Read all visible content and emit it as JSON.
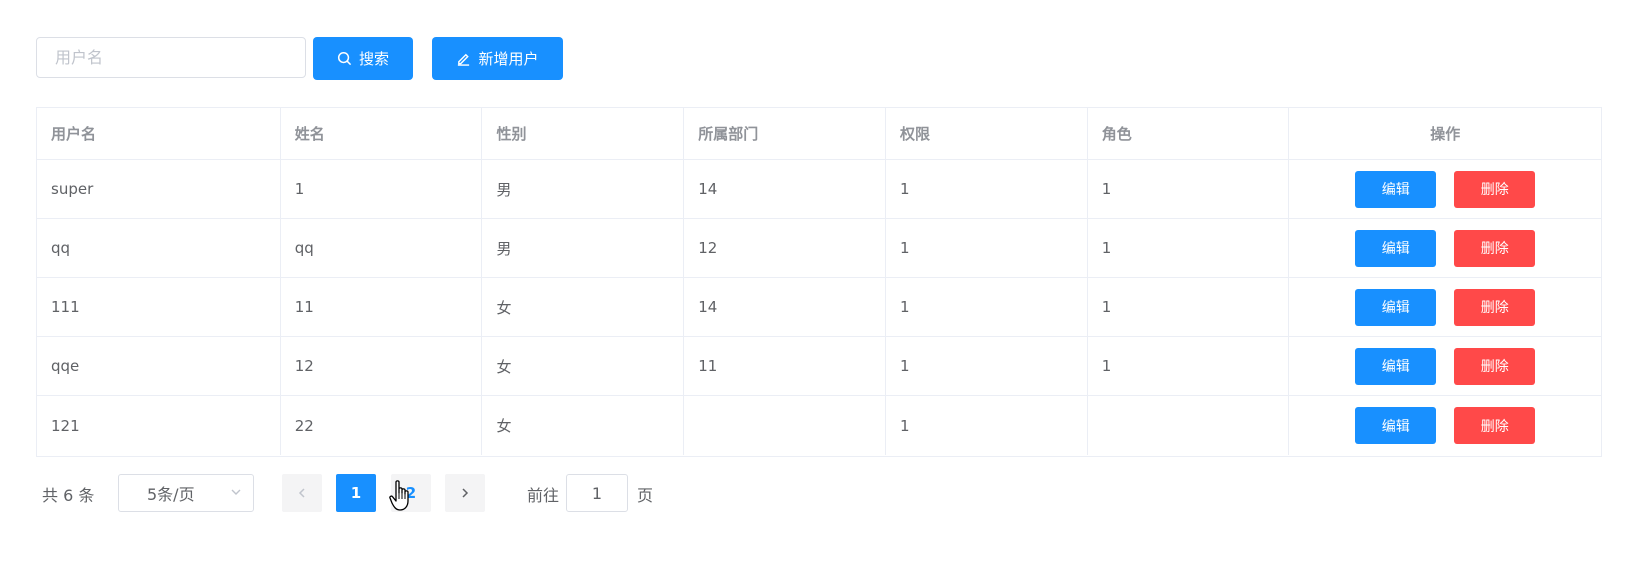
{
  "toolbar": {
    "search_placeholder": "用户名",
    "search_value": "",
    "search_label": "搜索",
    "add_label": "新增用户",
    "search_icon": "search-icon",
    "add_icon": "edit-icon"
  },
  "table": {
    "headers": [
      "用户名",
      "姓名",
      "性别",
      "所属部门",
      "权限",
      "角色",
      "操作"
    ],
    "rows": [
      {
        "username": "super",
        "name": "1",
        "gender": "男",
        "dept": "14",
        "permission": "1",
        "role": "1"
      },
      {
        "username": "qq",
        "name": "qq",
        "gender": "男",
        "dept": "12",
        "permission": "1",
        "role": "1"
      },
      {
        "username": "111",
        "name": "11",
        "gender": "女",
        "dept": "14",
        "permission": "1",
        "role": "1"
      },
      {
        "username": "qqe",
        "name": "12",
        "gender": "女",
        "dept": "11",
        "permission": "1",
        "role": "1"
      },
      {
        "username": "121",
        "name": "22",
        "gender": "女",
        "dept": "",
        "permission": "1",
        "role": ""
      }
    ],
    "edit_label": "编辑",
    "delete_label": "删除"
  },
  "pagination": {
    "total_text": "共 6 条",
    "page_size": "5条/页",
    "pages": [
      "1",
      "2"
    ],
    "current_page": "1",
    "goto_label": "前往",
    "goto_value": "1",
    "page_suffix": "页"
  },
  "colors": {
    "primary": "#1890ff",
    "danger": "#ff4949",
    "border": "#ebeef5"
  }
}
